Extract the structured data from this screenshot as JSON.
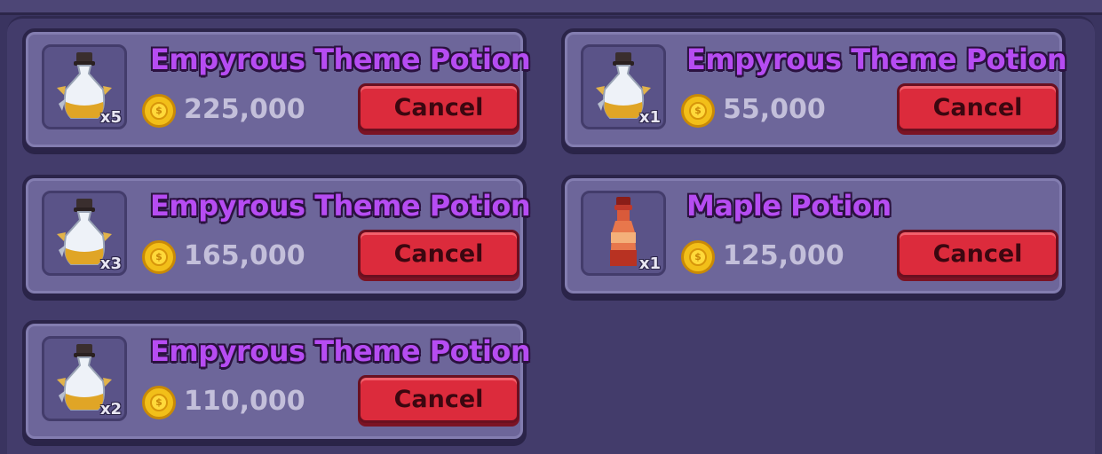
{
  "listings": [
    {
      "name": "Empyrous Theme Potion",
      "quantity": "x5",
      "price": "225,000",
      "button": "Cancel",
      "icon": "empyrous-potion-icon"
    },
    {
      "name": "Empyrous Theme Potion",
      "quantity": "x1",
      "price": "55,000",
      "button": "Cancel",
      "icon": "empyrous-potion-icon"
    },
    {
      "name": "Empyrous Theme Potion",
      "quantity": "x3",
      "price": "165,000",
      "button": "Cancel",
      "icon": "empyrous-potion-icon"
    },
    {
      "name": "Maple Potion",
      "quantity": "x1",
      "price": "125,000",
      "button": "Cancel",
      "icon": "maple-potion-icon"
    },
    {
      "name": "Empyrous Theme Potion",
      "quantity": "x2",
      "price": "110,000",
      "button": "Cancel",
      "icon": "empyrous-potion-icon"
    }
  ],
  "coin_icon": "gold-coin-icon",
  "colors": {
    "title": "#b64cf2",
    "button": "#dc2b3c",
    "card": "#6d669a",
    "coin": "#f2bf19"
  }
}
